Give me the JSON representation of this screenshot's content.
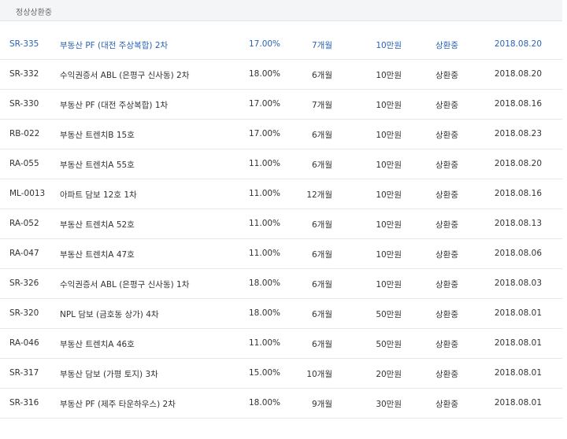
{
  "tab_label": "정상상환중",
  "rows": [
    {
      "code": "SR-335",
      "name": "부동산 PF (대전 주상복합) 2차",
      "rate": "17.00%",
      "term": "7개월",
      "amount": "10만원",
      "status": "상환중",
      "date": "2018.08.20",
      "active": true
    },
    {
      "code": "SR-332",
      "name": "수익권증서 ABL (은평구 신사동) 2차",
      "rate": "18.00%",
      "term": "6개월",
      "amount": "10만원",
      "status": "상환중",
      "date": "2018.08.20",
      "active": false
    },
    {
      "code": "SR-330",
      "name": "부동산 PF (대전 주상복합) 1차",
      "rate": "17.00%",
      "term": "7개월",
      "amount": "10만원",
      "status": "상환중",
      "date": "2018.08.16",
      "active": false
    },
    {
      "code": "RB-022",
      "name": "부동산 트렌치B 15호",
      "rate": "17.00%",
      "term": "6개월",
      "amount": "10만원",
      "status": "상환중",
      "date": "2018.08.23",
      "active": false
    },
    {
      "code": "RA-055",
      "name": "부동산 트렌치A 55호",
      "rate": "11.00%",
      "term": "6개월",
      "amount": "10만원",
      "status": "상환중",
      "date": "2018.08.20",
      "active": false
    },
    {
      "code": "ML-0013",
      "name": "아파트 담보 12호 1차",
      "rate": "11.00%",
      "term": "12개월",
      "amount": "10만원",
      "status": "상환중",
      "date": "2018.08.16",
      "active": false
    },
    {
      "code": "RA-052",
      "name": "부동산 트렌치A 52호",
      "rate": "11.00%",
      "term": "6개월",
      "amount": "10만원",
      "status": "상환중",
      "date": "2018.08.13",
      "active": false
    },
    {
      "code": "RA-047",
      "name": "부동산 트렌치A 47호",
      "rate": "11.00%",
      "term": "6개월",
      "amount": "10만원",
      "status": "상환중",
      "date": "2018.08.06",
      "active": false
    },
    {
      "code": "SR-326",
      "name": "수익권증서 ABL (은평구 신사동) 1차",
      "rate": "18.00%",
      "term": "6개월",
      "amount": "10만원",
      "status": "상환중",
      "date": "2018.08.03",
      "active": false
    },
    {
      "code": "SR-320",
      "name": "NPL 담보 (금호동 상가) 4차",
      "rate": "18.00%",
      "term": "6개월",
      "amount": "50만원",
      "status": "상환중",
      "date": "2018.08.01",
      "active": false
    },
    {
      "code": "RA-046",
      "name": "부동산 트렌치A 46호",
      "rate": "11.00%",
      "term": "6개월",
      "amount": "50만원",
      "status": "상환중",
      "date": "2018.08.01",
      "active": false
    },
    {
      "code": "SR-317",
      "name": "부동산 담보 (가평 토지) 3차",
      "rate": "15.00%",
      "term": "10개월",
      "amount": "20만원",
      "status": "상환중",
      "date": "2018.08.01",
      "active": false
    },
    {
      "code": "SR-316",
      "name": "부동산 PF (제주 타운하우스) 2차",
      "rate": "18.00%",
      "term": "9개월",
      "amount": "30만원",
      "status": "상환중",
      "date": "2018.08.01",
      "active": false
    }
  ]
}
